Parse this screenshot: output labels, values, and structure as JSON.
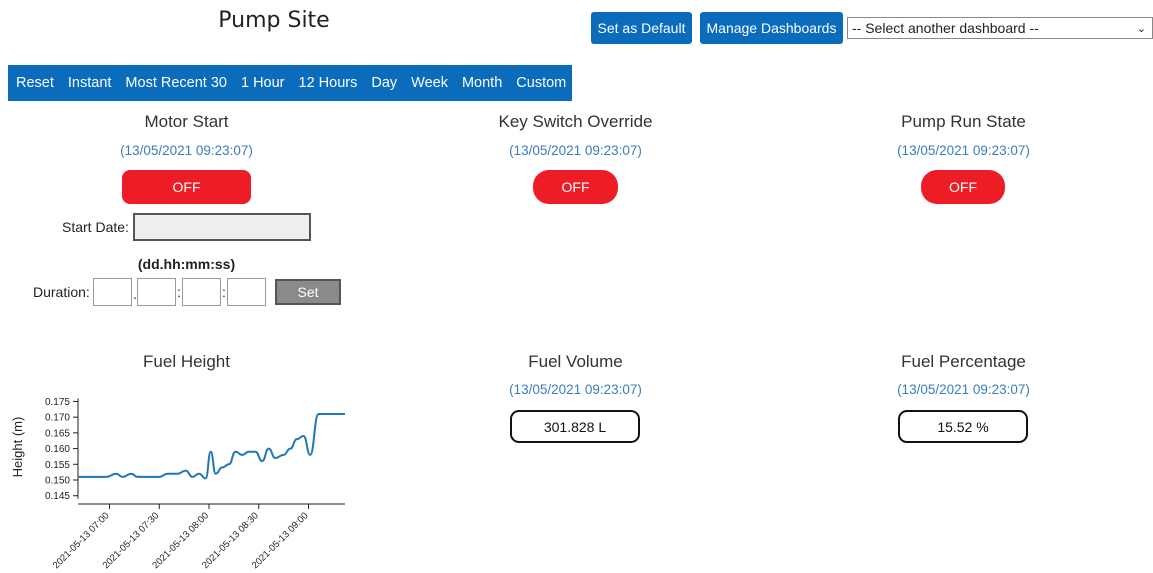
{
  "header": {
    "title": "Pump Site",
    "set_default": "Set as Default",
    "manage": "Manage Dashboards",
    "select_value": "-- Select another dashboard --"
  },
  "range_tabs": [
    "Reset",
    "Instant",
    "Most Recent 30",
    "1 Hour",
    "12 Hours",
    "Day",
    "Week",
    "Month",
    "Custom"
  ],
  "widgets": {
    "motor_start": {
      "title": "Motor Start",
      "timestamp": "(13/05/2021 09:23:07)",
      "state": "OFF"
    },
    "key_switch": {
      "title": "Key Switch Override",
      "timestamp": "(13/05/2021 09:23:07)",
      "state": "OFF"
    },
    "pump_run": {
      "title": "Pump Run State",
      "timestamp": "(13/05/2021 09:23:07)",
      "state": "OFF"
    },
    "fuel_height": {
      "title": "Fuel Height"
    },
    "fuel_volume": {
      "title": "Fuel Volume",
      "timestamp": "(13/05/2021 09:23:07)",
      "value": "301.828 L"
    },
    "fuel_percentage": {
      "title": "Fuel Percentage",
      "timestamp": "(13/05/2021 09:23:07)",
      "value": "15.52 %"
    }
  },
  "schedule": {
    "start_label": "Start Date:",
    "format_hint": "(dd.hh:mm:ss)",
    "duration_label": "Duration:",
    "sep_dot": ".",
    "sep_colon": ":",
    "set_label": "Set"
  },
  "colors": {
    "accent": "#0a6cba",
    "off": "#ee1c24",
    "timestamp": "#3a7dbf",
    "line": "#1f77b4"
  },
  "chart_data": {
    "type": "line",
    "ylabel": "Height (m)",
    "ylim": [
      0.143,
      0.178
    ],
    "xlim": [
      "2021-05-13T06:41",
      "2021-05-13T09:22"
    ],
    "yticks": [
      0.145,
      0.15,
      0.155,
      0.16,
      0.165,
      0.17,
      0.175
    ],
    "ytick_labels": [
      "0.145",
      "0.150",
      "0.155",
      "0.160",
      "0.165",
      "0.170",
      "0.175"
    ],
    "xticks": [
      "2021-05-13T07:00",
      "2021-05-13T07:30",
      "2021-05-13T08:00",
      "2021-05-13T08:30",
      "2021-05-13T09:00"
    ],
    "xtick_labels": [
      "2021-05-13 07:00",
      "2021-05-13 07:30",
      "2021-05-13 08:00",
      "2021-05-13 08:30",
      "2021-05-13 09:00"
    ],
    "series": [
      {
        "x": [
          "2021-05-13T06:41",
          "2021-05-13T06:50",
          "2021-05-13T06:58",
          "2021-05-13T07:04",
          "2021-05-13T07:08",
          "2021-05-13T07:13",
          "2021-05-13T07:17",
          "2021-05-13T07:22",
          "2021-05-13T07:30",
          "2021-05-13T07:35",
          "2021-05-13T07:41",
          "2021-05-13T07:46",
          "2021-05-13T07:50",
          "2021-05-13T07:54",
          "2021-05-13T07:58",
          "2021-05-13T08:01",
          "2021-05-13T08:04",
          "2021-05-13T08:08",
          "2021-05-13T08:12",
          "2021-05-13T08:16",
          "2021-05-13T08:20",
          "2021-05-13T08:24",
          "2021-05-13T08:28",
          "2021-05-13T08:32",
          "2021-05-13T08:36",
          "2021-05-13T08:40",
          "2021-05-13T08:45",
          "2021-05-13T08:49",
          "2021-05-13T08:53",
          "2021-05-13T08:57",
          "2021-05-13T09:01",
          "2021-05-13T09:06",
          "2021-05-13T09:10",
          "2021-05-13T09:14",
          "2021-05-13T09:18",
          "2021-05-13T09:22"
        ],
        "y": [
          0.151,
          0.151,
          0.151,
          0.152,
          0.151,
          0.152,
          0.151,
          0.151,
          0.151,
          0.152,
          0.152,
          0.153,
          0.151,
          0.152,
          0.1505,
          0.159,
          0.152,
          0.154,
          0.155,
          0.159,
          0.158,
          0.159,
          0.159,
          0.156,
          0.16,
          0.157,
          0.158,
          0.16,
          0.163,
          0.164,
          0.158,
          0.171,
          0.171,
          0.171,
          0.171,
          0.171
        ]
      }
    ]
  }
}
